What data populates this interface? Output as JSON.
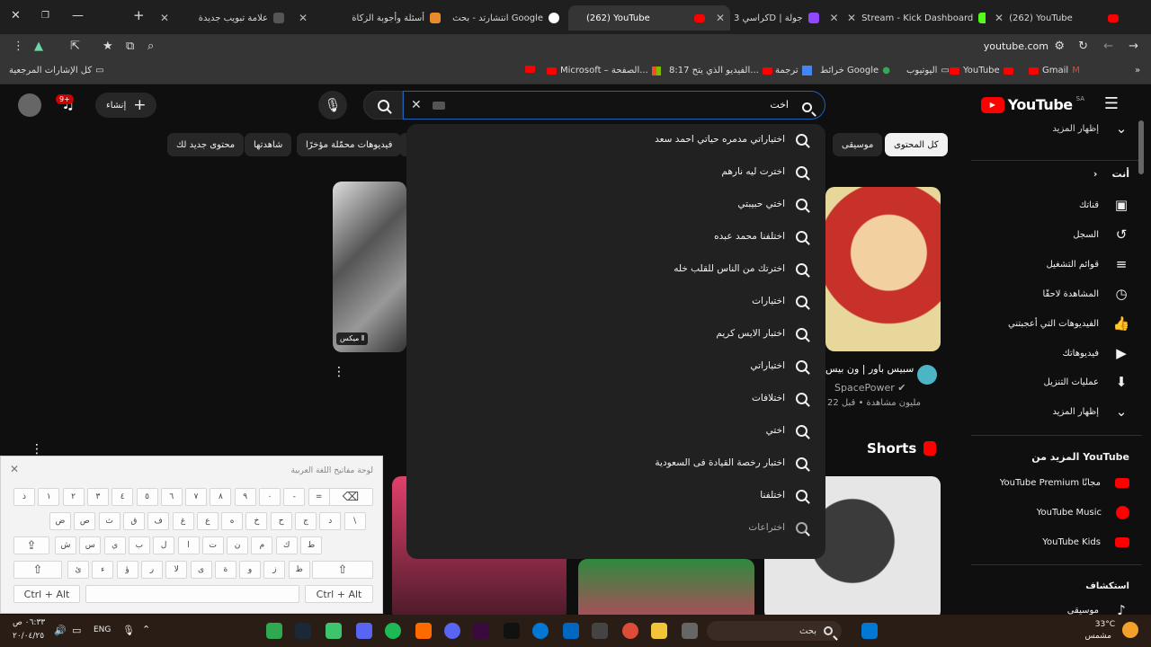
{
  "tabs": [
    {
      "title": "علامة تبويب جديدة",
      "active": false
    },
    {
      "title": "أسئلة وأجوبة الزكاة",
      "active": false
    },
    {
      "title": "انتشارتد - بحث Google",
      "active": false
    },
    {
      "title": "(262) YouTube",
      "active": true
    },
    {
      "title": "كراسي 3D | جولة",
      "active": false
    },
    {
      "title": "Stream - Kick Dashboard",
      "active": false
    },
    {
      "title": "(262) YouTube",
      "active": false
    }
  ],
  "toolbar": {
    "url": "youtube.com"
  },
  "bookmarks": {
    "all_bookmarks": "كل الإشارات المرجعية",
    "items": [
      "8:17 الفيديو الذي يتح...",
      "ترجمة",
      "خرائط Google",
      "اليوتيوب",
      "YouTube",
      "Gmail",
      "Microsoft – الصفحة..."
    ]
  },
  "youtube": {
    "logo": "YouTube",
    "logo_region": "SA",
    "search_value": "اخت",
    "create_label": "إنشاء",
    "notif_count": "9+",
    "chips": [
      "كل المحتوى",
      "موسيقى",
      "فيديوهات محمّلة مؤخرًا",
      "شاهدتها",
      "محتوى جديد لك"
    ],
    "sidebar": {
      "show_more_top": "إظهار المزيد",
      "you_label": "أنت",
      "items": [
        {
          "label": "قناتك",
          "icon": "channel-icon"
        },
        {
          "label": "السجل",
          "icon": "history-icon"
        },
        {
          "label": "قوائم التشغيل",
          "icon": "playlists-icon"
        },
        {
          "label": "المشاهدة لاحقًا",
          "icon": "watch-later-icon"
        },
        {
          "label": "الفيديوهات التي أعجبتني",
          "icon": "like-icon"
        },
        {
          "label": "فيديوهاتك",
          "icon": "your-videos-icon"
        },
        {
          "label": "عمليات التنزيل",
          "icon": "download-icon"
        },
        {
          "label": "إظهار المزيد",
          "icon": "chevron-down-icon"
        }
      ],
      "more_from": "المزيد من YouTube",
      "more_items": [
        "YouTube Premium مجانًا",
        "YouTube Music",
        "YouTube Kids"
      ],
      "explore": "استكشاف",
      "music": "موسيقى"
    },
    "suggestions": [
      "اختياراتي مدمره حياتي احمد سعد",
      "اخترت ليه نارهم",
      "اختي حبيبتي",
      "اختلفنا محمد عبده",
      "اخترتك من الناس للقلب خله",
      "اختيارات",
      "اختبار الايس كريم",
      "اختياراتي",
      "اختلافات",
      "اختي",
      "اختبار رخصة القيادة فى السعودية",
      "اختلفنا",
      "اختراعات"
    ],
    "video": {
      "title": "سبيس باور | ون بيس",
      "channel": "SpacePower",
      "meta": "22 مليون مشاهدة • قبل",
      "mix_label": "ميكس"
    },
    "shorts_label": "Shorts"
  },
  "keyboard": {
    "title": "لوحة مفاتيح اللغة العربية",
    "row1": [
      "ذ",
      "١",
      "٢",
      "٣",
      "٤",
      "٥",
      "٦",
      "٧",
      "٨",
      "٩",
      "٠",
      "-",
      "="
    ],
    "row2": [
      "ض",
      "ص",
      "ث",
      "ق",
      "ف",
      "غ",
      "ع",
      "ه",
      "خ",
      "ح",
      "ج",
      "د",
      "\\"
    ],
    "row3": [
      "ش",
      "س",
      "ي",
      "ب",
      "ل",
      "ا",
      "ت",
      "ن",
      "م",
      "ك",
      "ط"
    ],
    "row4": [
      "ئ",
      "ء",
      "ؤ",
      "ر",
      "لا",
      "ى",
      "ة",
      "و",
      "ز",
      "ظ"
    ],
    "ctrl_alt": "Ctrl + Alt"
  },
  "taskbar": {
    "time": "٠٦:٣٣ ص",
    "date": "٢٠/٠٤/٢٥",
    "lang": "ENG",
    "weather_temp": "33°C",
    "weather_desc": "مشمس",
    "search": "بحث"
  },
  "colors": {
    "yt_red": "#ff0000",
    "bg": "#0f0f0f",
    "chip": "#272727"
  }
}
